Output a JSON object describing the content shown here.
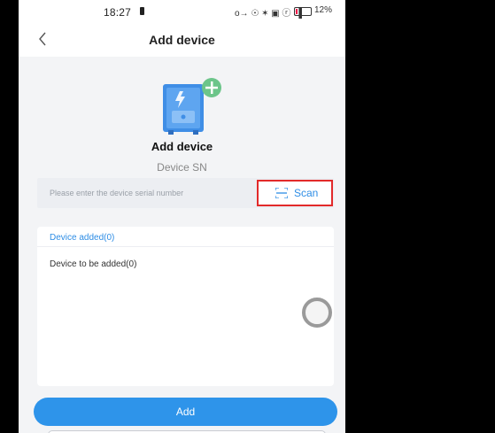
{
  "status_bar": {
    "time": "18:27",
    "icons": "o→ ☉ ✶ ▣ ⓡ ∶▐",
    "battery": "12%"
  },
  "nav": {
    "back_icon": "chevron-left-icon",
    "title": "Add device"
  },
  "hero": {
    "illustration": "device-add-illustration",
    "heading": "Add device",
    "subheading": "Device SN"
  },
  "serial_input": {
    "placeholder": "Please enter the device serial number",
    "value": ""
  },
  "scan": {
    "icon": "scan-frame-icon",
    "label": "Scan",
    "highlight_color": "#e22a2a"
  },
  "device_list": {
    "added_label": "Device added(0)",
    "to_be_added_label": "Device to be added(0)"
  },
  "primary_action": {
    "label": "Add"
  },
  "colors": {
    "accent": "#2e94ea",
    "link": "#2e8de5",
    "background": "#f3f4f6"
  }
}
